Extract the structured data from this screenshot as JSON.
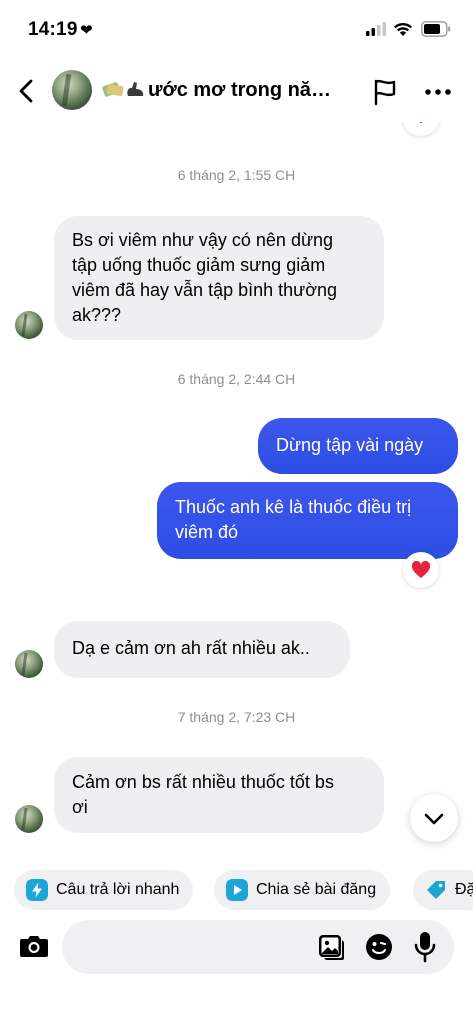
{
  "status_bar": {
    "time": "14:19",
    "heart": "❤"
  },
  "header": {
    "title": "ước mơ trong năm...",
    "title_emoji": "money-bag-and-flexed-biceps-emoji",
    "avatar_icon": "profile-photo"
  },
  "messages": [
    {
      "type": "timestamp",
      "text": "6 tháng 2, 1:55 CH"
    },
    {
      "type": "incoming",
      "lines": [
        "Bs ơi viêm như vậy có nên dừng",
        "tập uống thuốc giảm sưng giảm",
        "viêm đã hay vẫn tập bình thường",
        "ak???"
      ]
    },
    {
      "type": "timestamp",
      "text": "6 tháng 2, 2:44 CH"
    },
    {
      "type": "outgoing",
      "lines": [
        "Dừng tập vài ngày"
      ]
    },
    {
      "type": "outgoing",
      "lines": [
        "Thuốc anh kê là thuốc điều trị",
        "viêm đó"
      ],
      "reaction": "❤️"
    },
    {
      "type": "incoming",
      "lines": [
        "Dạ e cảm ơn ah rất nhiều ak.."
      ]
    },
    {
      "type": "timestamp",
      "text": "7 tháng 2, 7:23 CH"
    },
    {
      "type": "incoming",
      "lines": [
        "Cảm ơn bs rất nhiều thuốc tốt bs",
        "ơi"
      ]
    }
  ],
  "quick_actions": [
    {
      "label": "Câu trả lời nhanh",
      "icon": "lightning-icon",
      "color": "#1ba6d6"
    },
    {
      "label": "Chia sẻ bài đăng",
      "icon": "play-icon",
      "color": "#1ba6d6"
    },
    {
      "label": "Đặ",
      "icon": "tag-icon",
      "color": "#1ba6d6"
    }
  ],
  "composer": {
    "placeholder": ""
  },
  "colors": {
    "outgoing_bubble": "#3451ea",
    "incoming_bubble": "#efeff1",
    "timestamp": "#8e8e93"
  }
}
